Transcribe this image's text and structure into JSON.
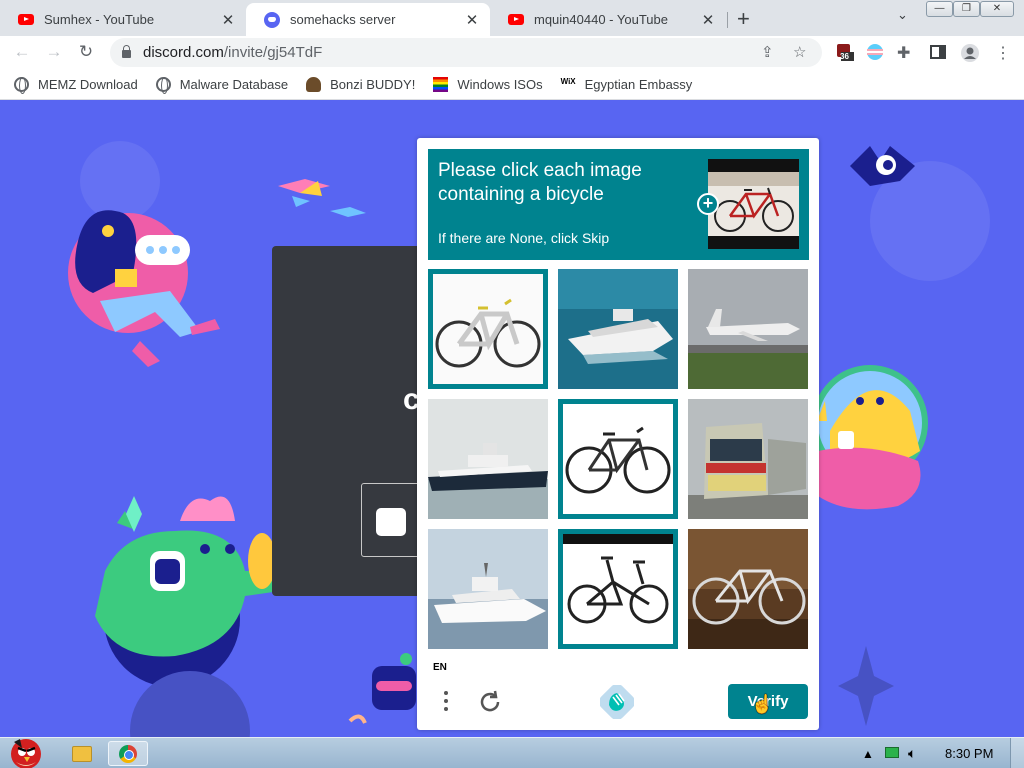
{
  "browser": {
    "tabs": [
      {
        "title": "Sumhex - YouTube",
        "icon": "youtube-icon",
        "active": false
      },
      {
        "title": "somehacks server",
        "icon": "discord-icon",
        "active": true
      },
      {
        "title": "mquin40440 - YouTube",
        "icon": "youtube-icon",
        "active": false
      }
    ],
    "url_domain": "discord.com",
    "url_path": "/invite/gj54TdF",
    "extension_badge": "36",
    "bookmarks": [
      {
        "label": "MEMZ Download",
        "icon": "globe-icon"
      },
      {
        "label": "Malware Database",
        "icon": "globe-icon"
      },
      {
        "label": "Bonzi BUDDY!",
        "icon": "bonzi-icon"
      },
      {
        "label": "Windows ISOs",
        "icon": "rainbow-flag-icon"
      },
      {
        "label": "Egyptian Embassy",
        "icon": "wix-icon",
        "icon_text": "WiX"
      }
    ]
  },
  "captcha": {
    "prompt_line": "Please click each image containing a bicycle",
    "skip_hint": "If there are None, click Skip",
    "language": "EN",
    "verify_label": "Verify",
    "accent_color": "#00838f",
    "tiles": [
      {
        "subject": "bicycle",
        "selected": true
      },
      {
        "subject": "yacht",
        "selected": false
      },
      {
        "subject": "airplane",
        "selected": false
      },
      {
        "subject": "ship",
        "selected": false
      },
      {
        "subject": "bicycle",
        "selected": true
      },
      {
        "subject": "train",
        "selected": false
      },
      {
        "subject": "yacht",
        "selected": false
      },
      {
        "subject": "folding-bicycle",
        "selected": true
      },
      {
        "subject": "bicycle",
        "selected": false
      }
    ]
  },
  "taskbar": {
    "clock": "8:30 PM"
  },
  "colors": {
    "page_background": "#5865f2",
    "dark_card": "#36393f"
  }
}
